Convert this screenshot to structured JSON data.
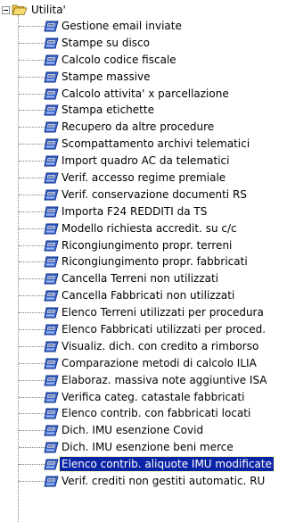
{
  "tree": {
    "root": {
      "label": "Utilita'",
      "expanded": true,
      "icon": "folder-open-icon"
    },
    "item_icon": "procedure-icon",
    "selection_color": "#0a24a6",
    "items": [
      {
        "label": "Gestione email inviate"
      },
      {
        "label": "Stampe su disco"
      },
      {
        "label": "Calcolo codice fiscale"
      },
      {
        "label": "Stampe massive"
      },
      {
        "label": "Calcolo attivita' x parcellazione"
      },
      {
        "label": "Stampa etichette"
      },
      {
        "label": "Recupero da altre procedure"
      },
      {
        "label": "Scompattamento archivi telematici"
      },
      {
        "label": "Import quadro AC da telematici"
      },
      {
        "label": "Verif. accesso regime premiale"
      },
      {
        "label": "Verif. conservazione documenti RS"
      },
      {
        "label": "Importa F24 REDDITI da TS"
      },
      {
        "label": "Modello richiesta accredit. su c/c"
      },
      {
        "label": "Ricongiungimento propr. terreni"
      },
      {
        "label": "Ricongiungimento propr. fabbricati"
      },
      {
        "label": "Cancella Terreni non utilizzati"
      },
      {
        "label": "Cancella Fabbricati non utilizzati"
      },
      {
        "label": "Elenco Terreni utilizzati per procedura"
      },
      {
        "label": "Elenco Fabbricati utilizzati per proced."
      },
      {
        "label": "Visualiz. dich. con credito a rimborso"
      },
      {
        "label": "Comparazione metodi di calcolo ILIA"
      },
      {
        "label": "Elaboraz. massiva note aggiuntive ISA"
      },
      {
        "label": "Verifica categ. catastale fabbricati"
      },
      {
        "label": "Elenco contrib. con fabbricati locati"
      },
      {
        "label": "Dich. IMU esenzione Covid"
      },
      {
        "label": "Dich. IMU esenzione beni merce"
      },
      {
        "label": "Elenco contrib. aliquote IMU modificate",
        "selected": true
      },
      {
        "label": "Verif. crediti non gestiti automatic. RU"
      }
    ]
  }
}
